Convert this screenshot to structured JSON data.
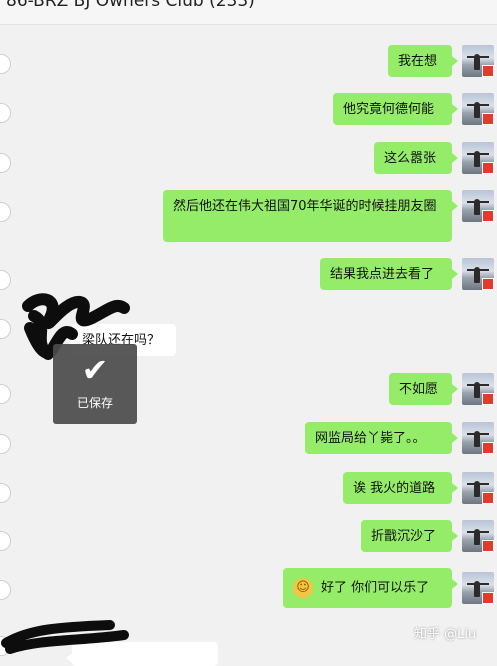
{
  "header": {
    "title": "86-BRZ BJ Owners Club (233)"
  },
  "messages": [
    {
      "text": "我在想"
    },
    {
      "text": "他究竟何德何能"
    },
    {
      "text": "这么嚣张"
    },
    {
      "text": "然后他还在伟大祖国70年华诞的时候挂朋友圈"
    },
    {
      "text": "结果我点进去看了"
    },
    {
      "text": "梁队还在吗？"
    },
    {
      "text": "不如愿"
    },
    {
      "text": "网监局给丫毙了。。"
    },
    {
      "text": "诶 我火的道路"
    },
    {
      "text": "折戬沉沙了"
    },
    {
      "text": "好了 你们可以乐了"
    }
  ],
  "toast": {
    "label": "已保存"
  },
  "watermark": {
    "text": "知乎 @Liu"
  }
}
